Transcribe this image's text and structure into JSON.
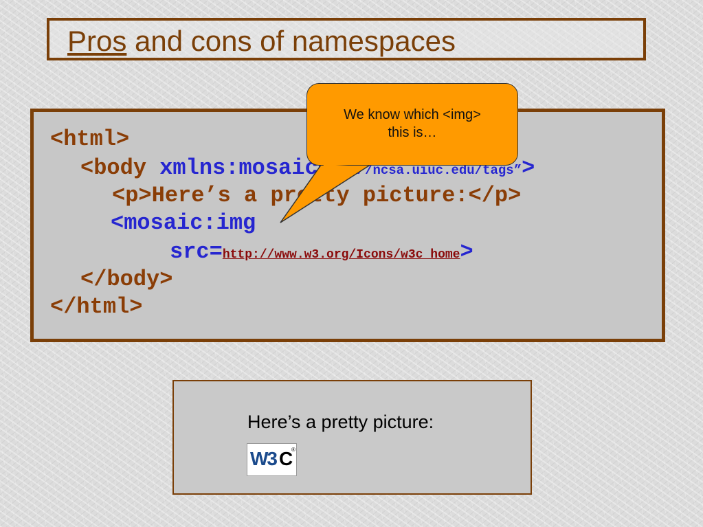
{
  "slide": {
    "title_prefix": "Pros",
    "title_rest": " and cons of namespaces"
  },
  "code": {
    "line1": "<html>",
    "line2_tag": "<body ",
    "line2_attr": "xmlns:mosaic",
    "line2_value": "http://ncsa.uiuc.edu/tags”",
    "line2_end": ">",
    "line3": "<p>Here’s a pretty picture:</p>",
    "line4": "<mosaic:img",
    "line5_attr": "src=",
    "line5_url": "http://www.w3.org/Icons/w3c_home",
    "line5_end": ">",
    "line6": "</body>",
    "line7": "</html>"
  },
  "callout": {
    "line1": "We know which <img>",
    "line2": "this is…",
    "fill_color": "#ff9a00"
  },
  "preview": {
    "text": "Here’s a pretty picture:",
    "logo_letters": "W3",
    "logo_c": "C",
    "logo_registered": "®"
  },
  "colors": {
    "border_brown": "#7a3f08",
    "code_brown": "#8a3d06",
    "code_blue": "#2626d0",
    "url_red": "#8a0a0a"
  }
}
